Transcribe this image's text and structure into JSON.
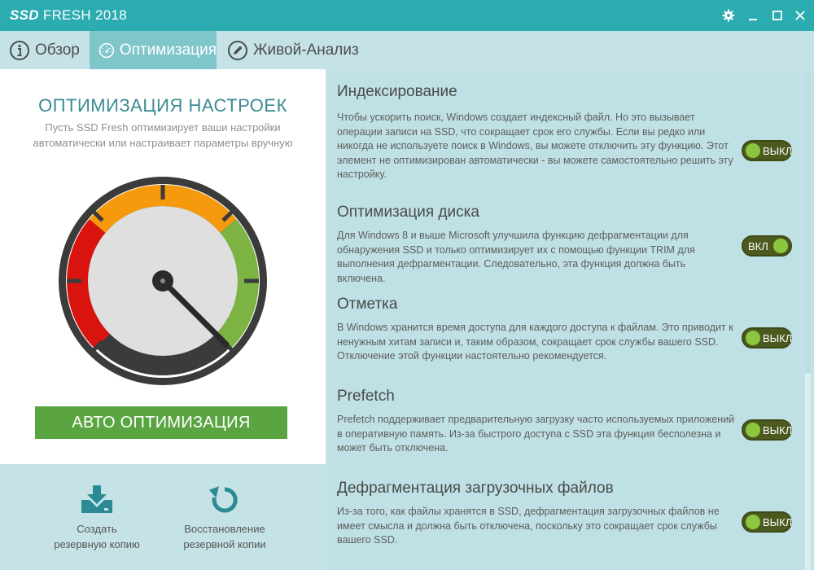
{
  "window": {
    "title_bold": "SSD",
    "title_rest": " FRESH 2018"
  },
  "tabs": [
    {
      "label": "Обзор",
      "icon": "info-icon"
    },
    {
      "label": "Оптимизация",
      "icon": "speedometer-icon",
      "active": true
    },
    {
      "label": "Живой-Анализ",
      "icon": "pencil-icon"
    }
  ],
  "left": {
    "title": "ОПТИМИЗАЦИЯ НАСТРОЕК",
    "description": "Пусть SSD Fresh оптимизирует ваши настройки автоматически или настраивает параметры вручную",
    "auto_button": "АВТО ОПТИМИЗАЦИЯ"
  },
  "backup": {
    "create_line1": "Создать",
    "create_line2": "резервную копию",
    "restore_line1": "Восстановление",
    "restore_line2": "резервной копии"
  },
  "settings": [
    {
      "title": "Индексирование",
      "description": "Чтобы ускорить поиск, Windows создает индексный файл. Но это вызывает операции записи на SSD, что сокращает срок его службы. Если вы редко или никогда не используете поиск в Windows, вы можете отключить эту функцию. Этот элемент не оптимизирован автоматически - вы можете самостоятельно решить эту настройку.",
      "state": "off",
      "toggle_label": "ВЫКЛ"
    },
    {
      "title": "Оптимизация диска",
      "description": "Для Windows 8 и выше Microsoft улучшила функцию дефрагментации для обнаружения SSD и только оптимизирует их с помощью функции TRIM для выполнения дефрагментации. Следовательно, эта функция должна быть включена.",
      "state": "on",
      "toggle_label": "ВКЛ"
    },
    {
      "title": "Отметка",
      "description": "В Windows хранится время доступа для каждого доступа к файлам. Это приводит к ненужным хитам записи и, таким образом, сокращает срок службы вашего SSD. Отключение этой функции настоятельно рекомендуется.",
      "state": "off",
      "toggle_label": "ВЫКЛ"
    },
    {
      "title": "Prefetch",
      "description": "Prefetch поддерживает предварительную загрузку часто используемых приложений в оперативную память. Из-за быстрого доступа с SSD эта функция бесполезна и может быть отключена.",
      "state": "off",
      "toggle_label": "ВЫКЛ"
    },
    {
      "title": "Дефрагментация загрузочных файлов",
      "description": "Из-за того, как файлы хранятся в SSD, дефрагментация загрузочных файлов не имеет смысла и должна быть отключена, поскольку это сокращает срок службы вашего SSD.",
      "state": "off",
      "toggle_label": "ВЫКЛ"
    }
  ],
  "colors": {
    "titlebar": "#2bacb0",
    "tab_active": "#7fc6cb",
    "accent_green": "#5aa541",
    "gauge_red": "#d9140f",
    "gauge_orange": "#f7990c",
    "gauge_green": "#7cb342",
    "toggle_bg": "#4c5a1e"
  }
}
